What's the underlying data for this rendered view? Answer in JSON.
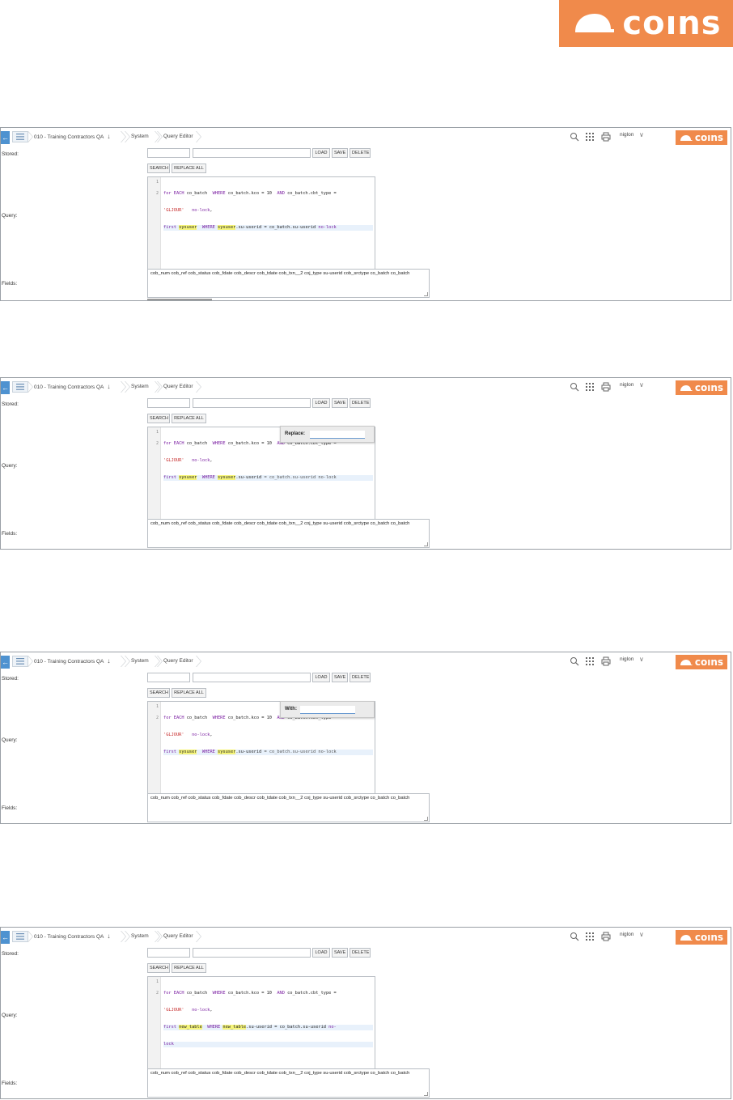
{
  "brand": {
    "logo_text": "coıns",
    "color": "#f08a4b"
  },
  "common": {
    "breadcrumb": {
      "company": "010 - Training Contractors QA",
      "module": "System",
      "page": "Query Editor"
    },
    "user": "niglon",
    "labels": {
      "stored": "Stored:",
      "query": "Query:",
      "fields": "Fields:"
    },
    "buttons": {
      "load": "LOAD",
      "save": "SAVE",
      "delete": "DELETE",
      "search": "SEARCH",
      "replace_all": "REPLACE ALL"
    },
    "gutter": [
      "1",
      "2"
    ],
    "code_line1": {
      "kw1": "for EACH",
      "t1": " co_batch  ",
      "kw2": "WHERE",
      "t2": " co_batch.kco = 10  ",
      "kw3": "AND",
      "t3": " co_batch.cbt_type ="
    },
    "code_line1b": {
      "str": "'GLJOUR'",
      "t": "   ",
      "kw": "no-lock",
      "p": ","
    },
    "fields_text": "cob_num cob_ref cob_status cob_fdate cob_descr cob_tdate cob_txn__2 coj_type su-userid cob_srctype co_batch co_batch"
  },
  "screens": [
    {
      "line2": {
        "kw1": "first",
        "ident1": "sysuser",
        "kw2": "WHERE",
        "ident2": "sysuser",
        "rest": ".su-userid = co_batch.su-userid ",
        "kw3": "no-lock"
      }
    },
    {
      "line2": {
        "kw1": "first",
        "ident1": "sysuser",
        "kw2": "WHERE",
        "ident2": "sysuser",
        "rest": ".su-userid",
        "hidden": " = co_batch.su-userid no-lock"
      },
      "dialog": {
        "label": "Replace:",
        "value": ""
      }
    },
    {
      "line2": {
        "kw1": "first",
        "ident1": "sysuser",
        "kw2": "WHERE",
        "ident2": "sysuser",
        "rest": ".su-userid",
        "hidden": " = co_batch.su-userid no-lock"
      },
      "dialog": {
        "label": "With:",
        "value": ""
      }
    },
    {
      "line2": {
        "kw1": "first",
        "ident1": "new_table",
        "kw2": "WHERE",
        "ident2": "new_table",
        "rest": ".su-userid = co_batch.su-userid ",
        "kw3": "no-"
      },
      "line3": {
        "kw": "lock"
      }
    }
  ]
}
